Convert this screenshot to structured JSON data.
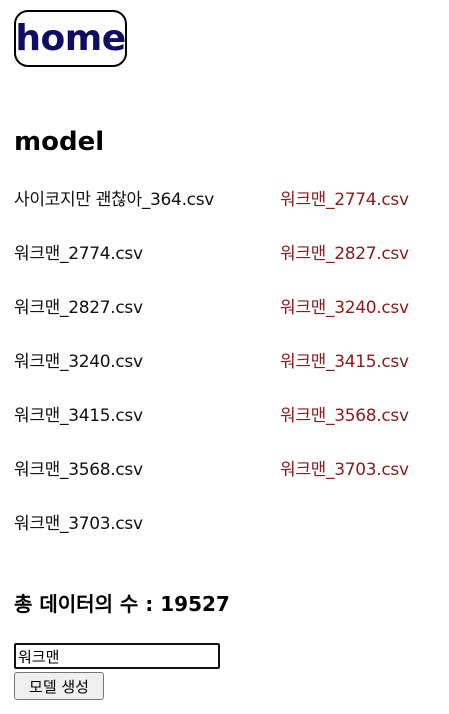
{
  "header": {
    "home_label": "home"
  },
  "section": {
    "title": "model"
  },
  "files": {
    "left": [
      "사이코지만 괜찮아_364.csv",
      "워크맨_2774.csv",
      "워크맨_2827.csv",
      "워크맨_3240.csv",
      "워크맨_3415.csv",
      "워크맨_3568.csv",
      "워크맨_3703.csv"
    ],
    "right": [
      "워크맨_2774.csv",
      "워크맨_2827.csv",
      "워크맨_3240.csv",
      "워크맨_3415.csv",
      "워크맨_3568.csv",
      "워크맨_3703.csv"
    ]
  },
  "summary": {
    "total_text": "총 데이터의 수 : 19527"
  },
  "form": {
    "input_value": "워크맨",
    "button_label": "모델 생성"
  },
  "colors": {
    "home_text": "#0e0e66",
    "right_link": "#8b1a1a"
  }
}
